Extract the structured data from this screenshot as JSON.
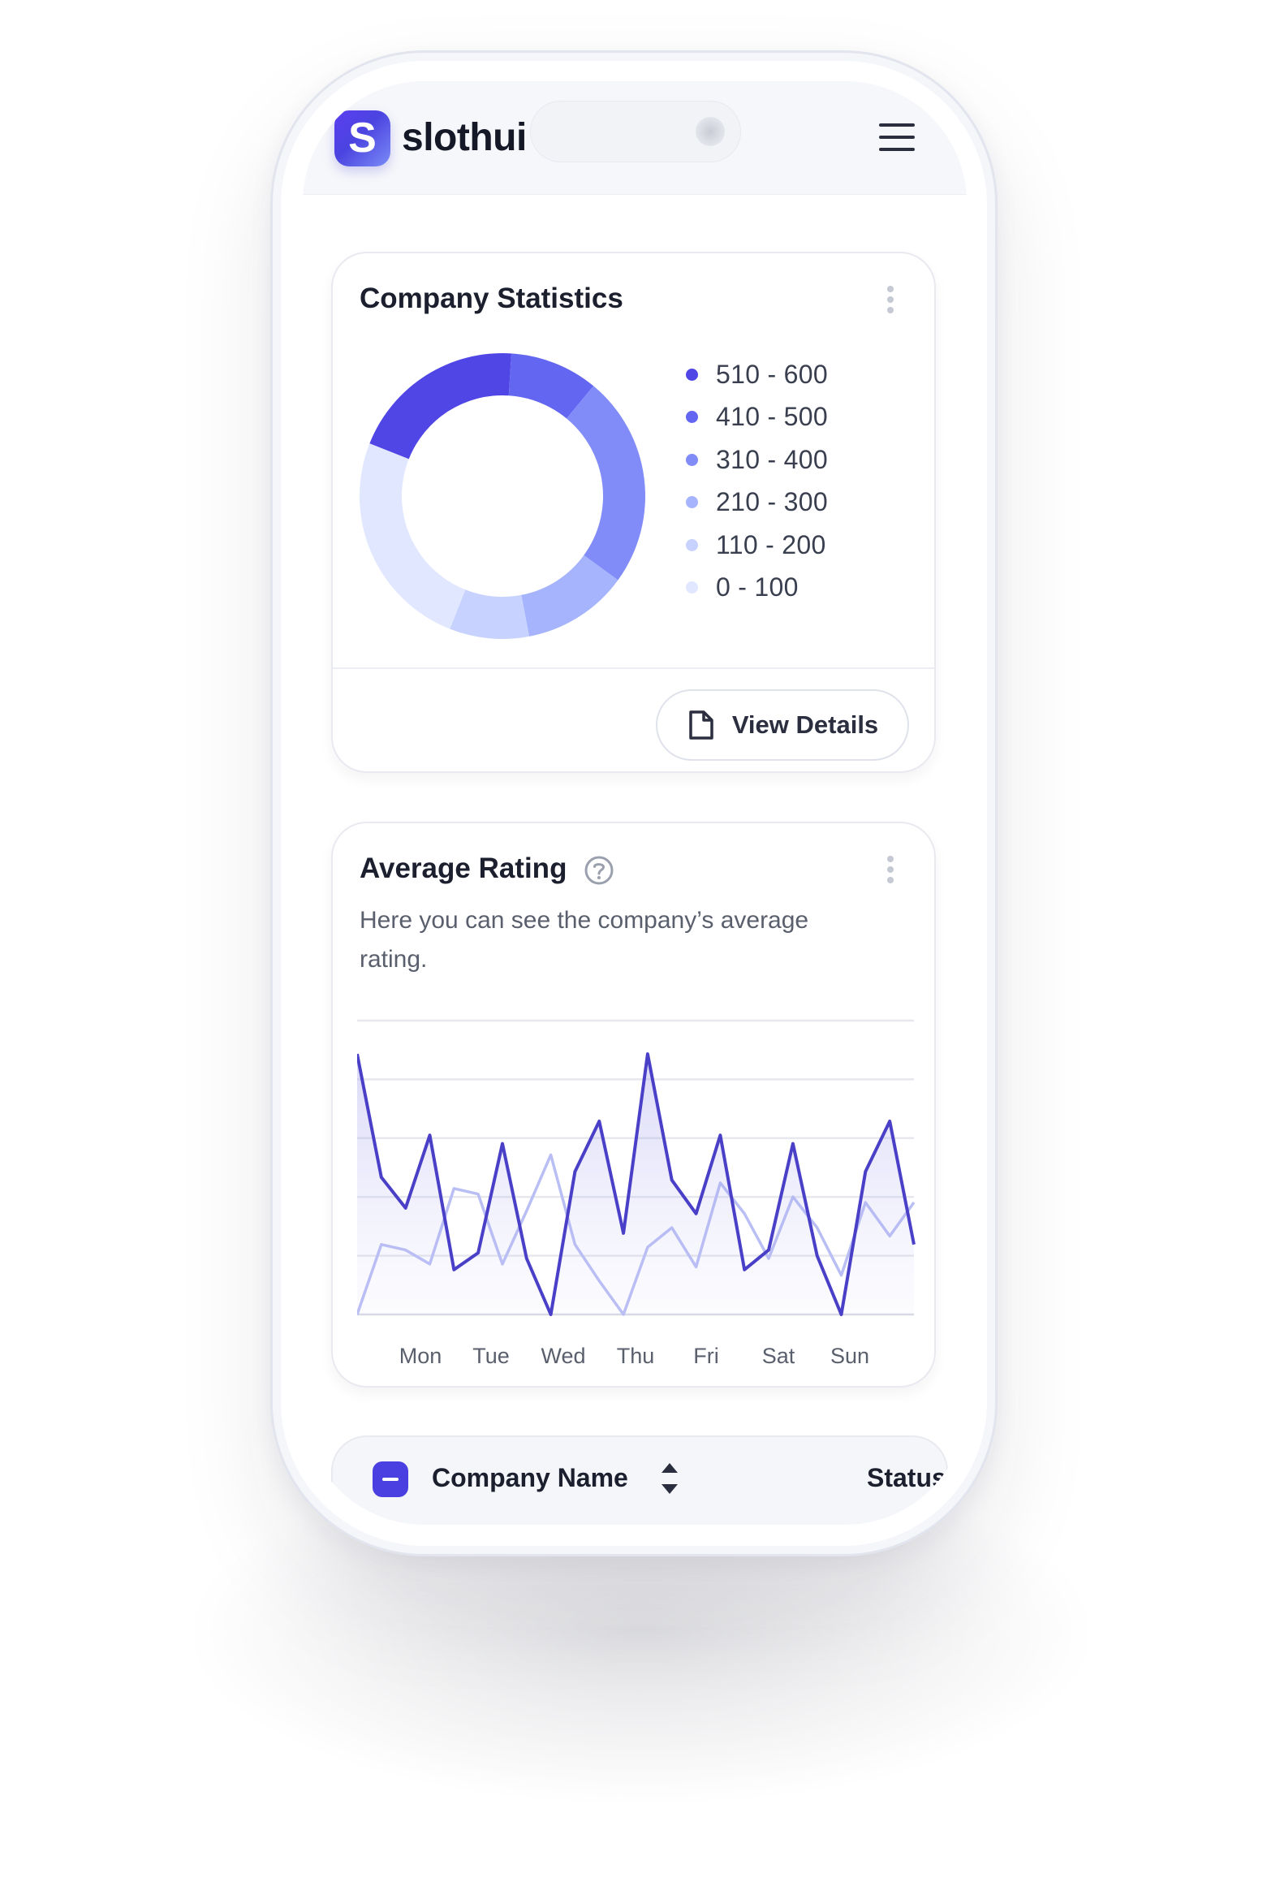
{
  "app": {
    "logo_letter": "S",
    "brand_name": "slothui"
  },
  "header": {
    "menu_icon": "hamburger-menu-icon"
  },
  "company_statistics": {
    "title": "Company Statistics",
    "button_label": "View Details",
    "button_icon": "document-icon"
  },
  "average_rating": {
    "title": "Average Rating",
    "subtitle": "Here you can see the company’s average rating.",
    "help_icon": "question-circle-icon"
  },
  "table": {
    "columns": [
      "Company Name",
      "Status"
    ]
  },
  "colors": {
    "accent": "#4a3fe0",
    "line_primary": "#4a40c8",
    "line_secondary": "#b9bef4"
  },
  "chart_data": [
    {
      "type": "pie",
      "donut": true,
      "categories": [
        "510 - 600",
        "410 - 500",
        "310 - 400",
        "210 - 300",
        "110 - 200",
        "0 - 100"
      ],
      "values": [
        20,
        10,
        24,
        12,
        9,
        25
      ],
      "colors": [
        "#4f46e5",
        "#6366f1",
        "#818cf8",
        "#a5b4fc",
        "#c7d2fe",
        "#e0e7ff"
      ],
      "legend": "right"
    },
    {
      "type": "area",
      "categories": [
        "Mon",
        "Tue",
        "Wed",
        "Thu",
        "Fri",
        "Sat",
        "Sun"
      ],
      "ylim": [
        0,
        100
      ],
      "grid": true,
      "series": [
        {
          "values": [
            93,
            49,
            38,
            64,
            16,
            22,
            61,
            20,
            0,
            51,
            69,
            29,
            93,
            48,
            36,
            64,
            16,
            23,
            61,
            21,
            0,
            51,
            69,
            25
          ]
        },
        {
          "values": [
            0,
            25,
            23,
            18,
            45,
            43,
            18,
            37,
            57,
            25,
            12,
            0,
            24,
            31,
            17,
            47,
            36,
            20,
            42,
            31,
            14,
            40,
            28,
            40
          ]
        }
      ]
    }
  ]
}
